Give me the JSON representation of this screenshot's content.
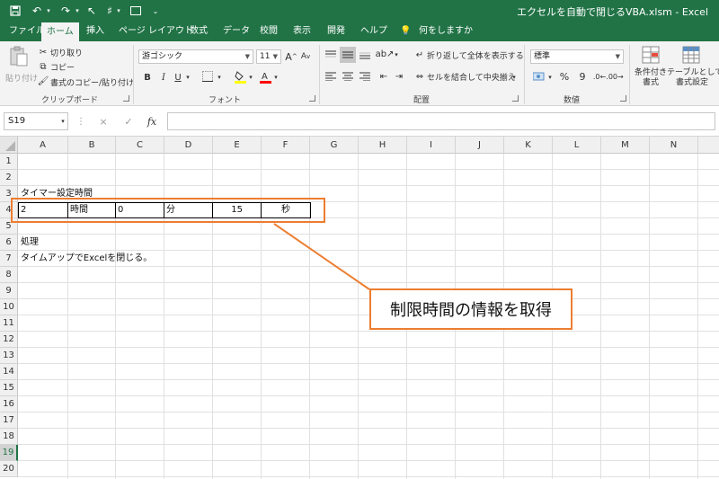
{
  "app": {
    "title": "エクセルを自動で閉じるVBA.xlsm - Excel",
    "tabs": [
      "ファイル",
      "ホーム",
      "挿入",
      "ページ レイアウト",
      "数式",
      "データ",
      "校閲",
      "表示",
      "開発",
      "ヘルプ"
    ],
    "active_tab": "ホーム",
    "tell_me": "何をしますか",
    "accent": "#217346"
  },
  "ribbon": {
    "clipboard": {
      "paste": "貼り付け",
      "cut": "切り取り",
      "copy": "コピー",
      "format_painter": "書式のコピー/貼り付け",
      "label": "クリップボード"
    },
    "font": {
      "name": "游ゴシック",
      "size": "11",
      "bold": "B",
      "italic": "I",
      "underline": "U",
      "grow": "A",
      "shrink": "A",
      "label": "フォント"
    },
    "alignment": {
      "wrap": "折り返して全体を表示する",
      "merge": "セルを結合して中央揃え",
      "label": "配置"
    },
    "number": {
      "format": "標準",
      "percent": "%",
      "comma": "9",
      "label": "数値"
    },
    "styles": {
      "conditional_line1": "条件付き",
      "conditional_line2": "書式",
      "table_line1": "テーブルとして",
      "table_line2": "書式設定"
    }
  },
  "formula_bar": {
    "name_box": "S19",
    "cancel": "×",
    "enter": "✓",
    "fx": "fx",
    "value": ""
  },
  "grid": {
    "columns": [
      "A",
      "B",
      "C",
      "D",
      "E",
      "F",
      "G",
      "H",
      "I",
      "J",
      "K",
      "L",
      "M",
      "N"
    ],
    "rows": [
      "1",
      "2",
      "3",
      "4",
      "5",
      "6",
      "7",
      "8",
      "9",
      "10",
      "11",
      "12",
      "13",
      "14",
      "15",
      "16",
      "17",
      "18",
      "19",
      "20"
    ],
    "selected_row": "19",
    "cells": {
      "A3": "タイマー設定時間",
      "A4": "2",
      "B4": "時間",
      "C4": "0",
      "D4": "分",
      "E4": "15",
      "F4": "秒",
      "A6": "処理",
      "A7": "タイムアップでExcelを閉じる。"
    }
  },
  "callout": {
    "text": "制限時間の情報を取得",
    "color": "#ed7d31"
  }
}
